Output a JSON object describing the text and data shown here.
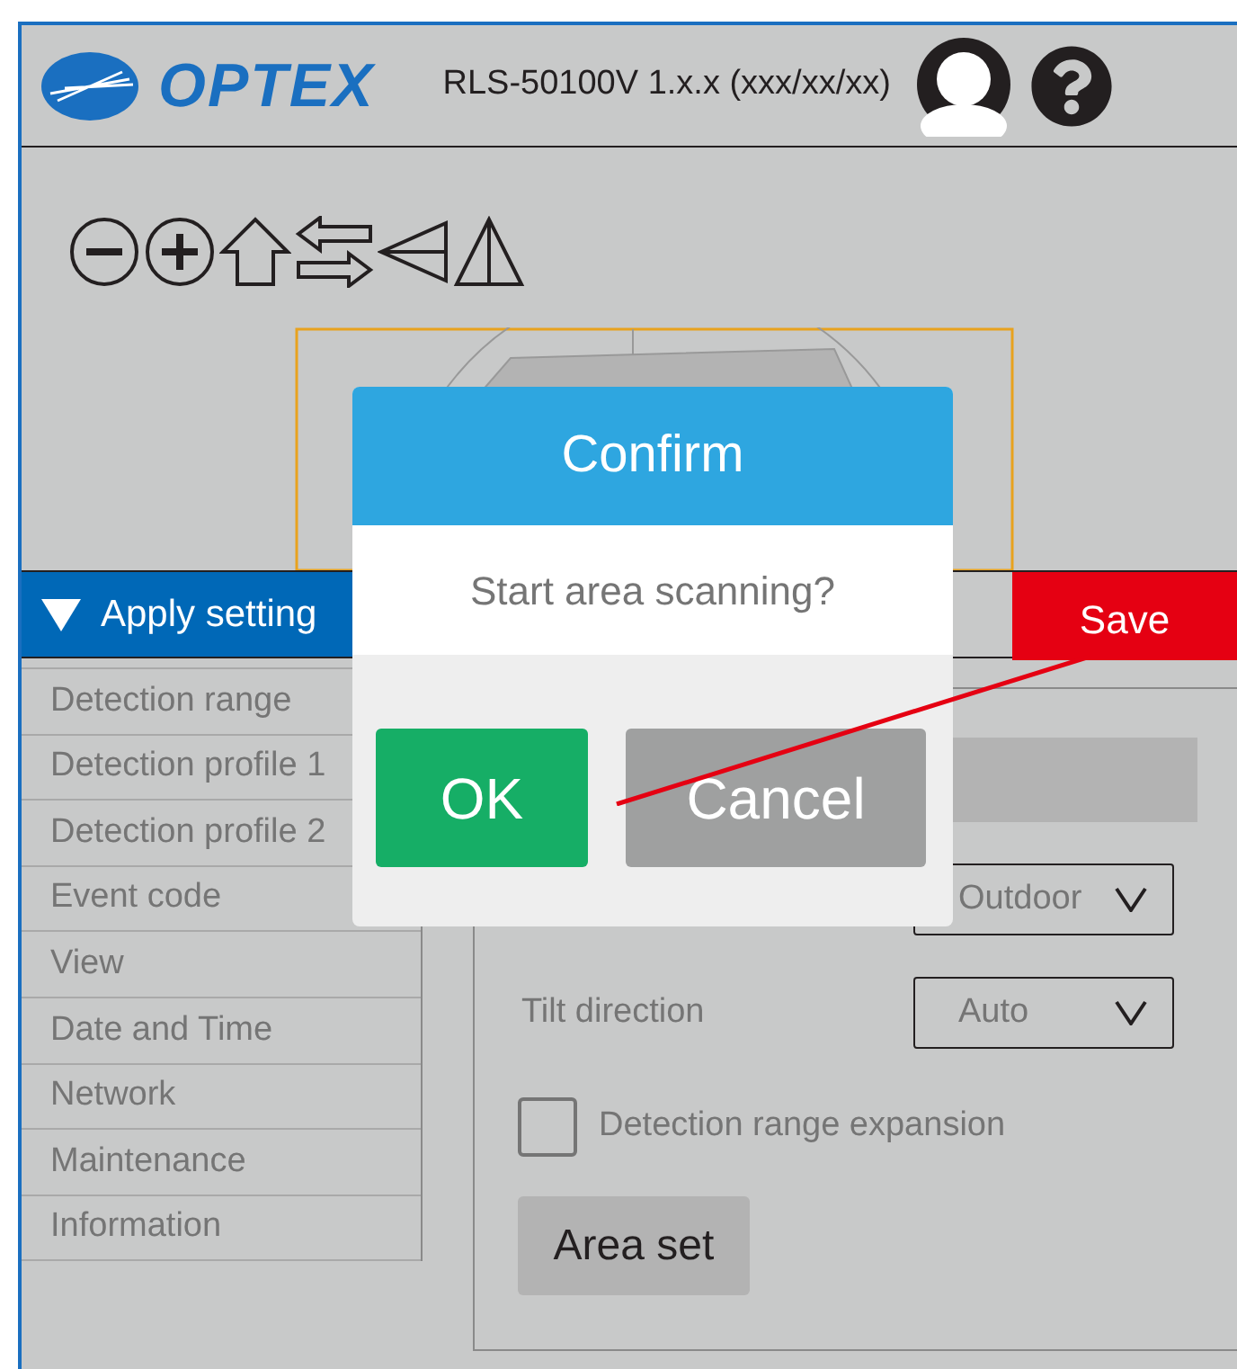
{
  "header": {
    "logo": "OPTEX",
    "title": "RLS-50100V 1.x.x (xxx/xx/xx)"
  },
  "toolbar": [
    {
      "kind": "zoom-out"
    },
    {
      "kind": "zoom-in"
    },
    {
      "kind": "home"
    },
    {
      "kind": "swap"
    },
    {
      "kind": "flip-horizontal"
    },
    {
      "kind": "flip-vertical"
    }
  ],
  "settings_bar": {
    "label": "Apply setting",
    "expanded": true,
    "save": "Save"
  },
  "sidebar": {
    "items": [
      {
        "label": "Detection range",
        "selected": false
      },
      {
        "label": "Detection profile 1",
        "selected": false
      },
      {
        "label": "Detection profile 2",
        "selected": false
      },
      {
        "label": "Event code",
        "selected": false
      },
      {
        "label": "View",
        "selected": false
      },
      {
        "label": "Date and Time",
        "selected": false
      },
      {
        "label": "Network",
        "selected": false
      },
      {
        "label": "Maintenance",
        "selected": false
      },
      {
        "label": "Information",
        "selected": false
      }
    ]
  },
  "panel": {
    "rows": [
      {
        "kind": "field"
      },
      {
        "kind": "select",
        "value": "Outdoor"
      },
      {
        "kind": "select",
        "label": "Tilt direction",
        "value": "Auto"
      },
      {
        "kind": "checkbox",
        "label": "Detection range expansion",
        "checked": false
      },
      {
        "kind": "button",
        "label": "Area set"
      }
    ]
  },
  "dialog": {
    "title": "Confirm",
    "message": "Start area scanning?",
    "buttons": [
      {
        "label": "OK",
        "kind": "primary"
      },
      {
        "label": "Cancel",
        "kind": "secondary"
      }
    ]
  }
}
